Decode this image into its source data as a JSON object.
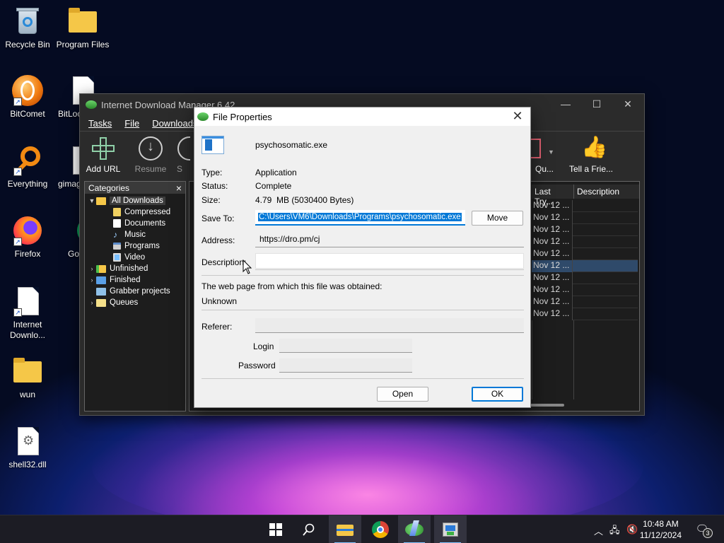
{
  "desktop": {
    "icons": [
      {
        "label": "Recycle Bin"
      },
      {
        "label": "Program Files"
      },
      {
        "label": "BitComet"
      },
      {
        "label": "BitLoc"
      },
      {
        "label": "Everything"
      },
      {
        "label": "gimag"
      },
      {
        "label": "Firefox"
      },
      {
        "label": "Go Chr"
      },
      {
        "label": "Internet Downlo..."
      },
      {
        "label": "wun"
      },
      {
        "label": "shell32.dll"
      }
    ]
  },
  "idm": {
    "title": "Internet Download Manager 6.42",
    "menu": [
      "Tasks",
      "File",
      "Downloads"
    ],
    "toolbar": {
      "add_url": "Add URL",
      "resume": "Resume",
      "stop_partial": "S",
      "queue_partial": "Qu...",
      "tell_friend": "Tell a Frie..."
    },
    "categories": {
      "header": "Categories",
      "close": "×",
      "items": [
        {
          "label": "All Downloads",
          "level": 0,
          "expanded": true
        },
        {
          "label": "Compressed",
          "level": 1
        },
        {
          "label": "Documents",
          "level": 1
        },
        {
          "label": "Music",
          "level": 1
        },
        {
          "label": "Programs",
          "level": 1
        },
        {
          "label": "Video",
          "level": 1
        },
        {
          "label": "Unfinished",
          "level": 0
        },
        {
          "label": "Finished",
          "level": 0
        },
        {
          "label": "Grabber projects",
          "level": 0
        },
        {
          "label": "Queues",
          "level": 0
        }
      ]
    },
    "list": {
      "columns": [
        "Last Try...",
        "Description"
      ],
      "rows": [
        "Nov 12 ...",
        "Nov 12 ...",
        "Nov 12 ...",
        "Nov 12 ...",
        "Nov 12 ...",
        "Nov 12 ...",
        "Nov 12 ...",
        "Nov 12 ...",
        "Nov 12 ...",
        "Nov 12 ..."
      ]
    }
  },
  "dialog": {
    "title": "File Properties",
    "file_name": "psychosomatic.exe",
    "type_label": "Type:",
    "type_value": "Application",
    "status_label": "Status:",
    "status_value": "Complete",
    "size_label": "Size:",
    "size_value": "4.79  MB (5030400 Bytes)",
    "saveto_label": "Save To:",
    "saveto_value": "C:\\Users\\VM6\\Downloads\\Programs\\psychosomatic.exe",
    "move_button": "Move",
    "address_label": "Address:",
    "address_value": "https://dro.pm/cj",
    "description_label": "Description:",
    "webpage_label": "The web page from which this file was obtained:",
    "webpage_value": "Unknown",
    "referer_label": "Referer:",
    "login_label": "Login",
    "password_label": "Password",
    "open_button": "Open",
    "ok_button": "OK"
  },
  "taskbar": {
    "time": "10:48 AM",
    "date": "11/12/2024",
    "notifications": "3"
  }
}
